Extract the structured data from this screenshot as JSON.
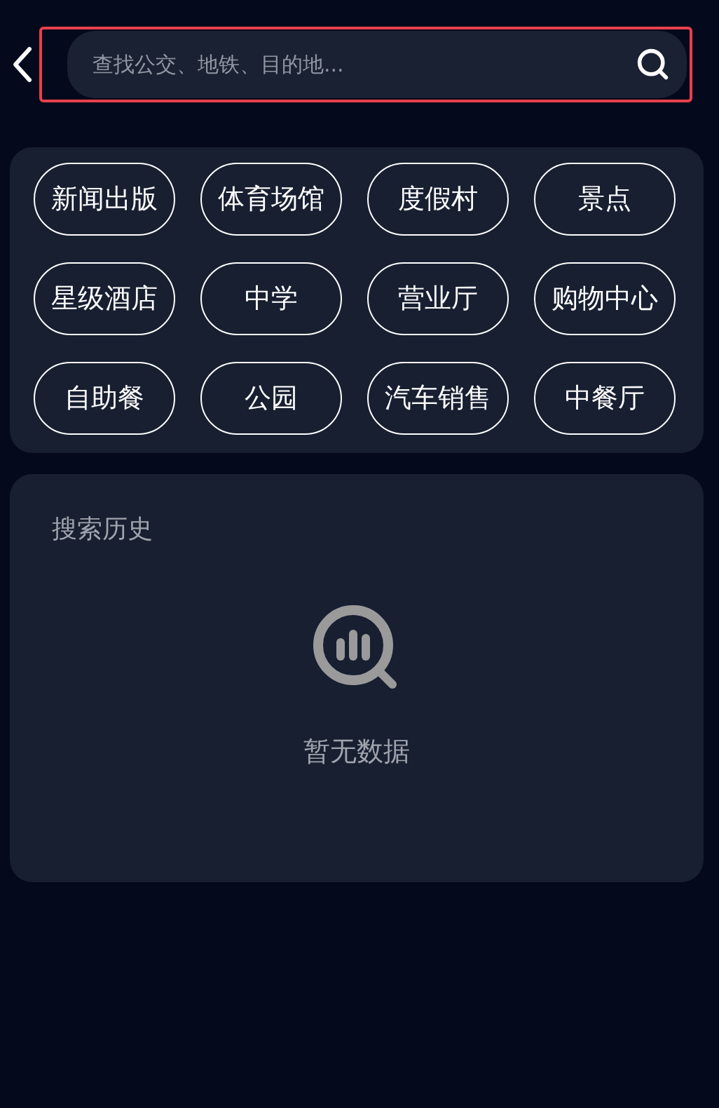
{
  "search": {
    "placeholder": "查找公交、地铁、目的地...",
    "highlighted": true
  },
  "categories": [
    "新闻出版",
    "体育场馆",
    "度假村",
    "景点",
    "星级酒店",
    "中学",
    "营业厅",
    "购物中心",
    "自助餐",
    "公园",
    "汽车销售",
    "中餐厅"
  ],
  "history": {
    "title": "搜索历史",
    "empty_text": "暂无数据"
  }
}
